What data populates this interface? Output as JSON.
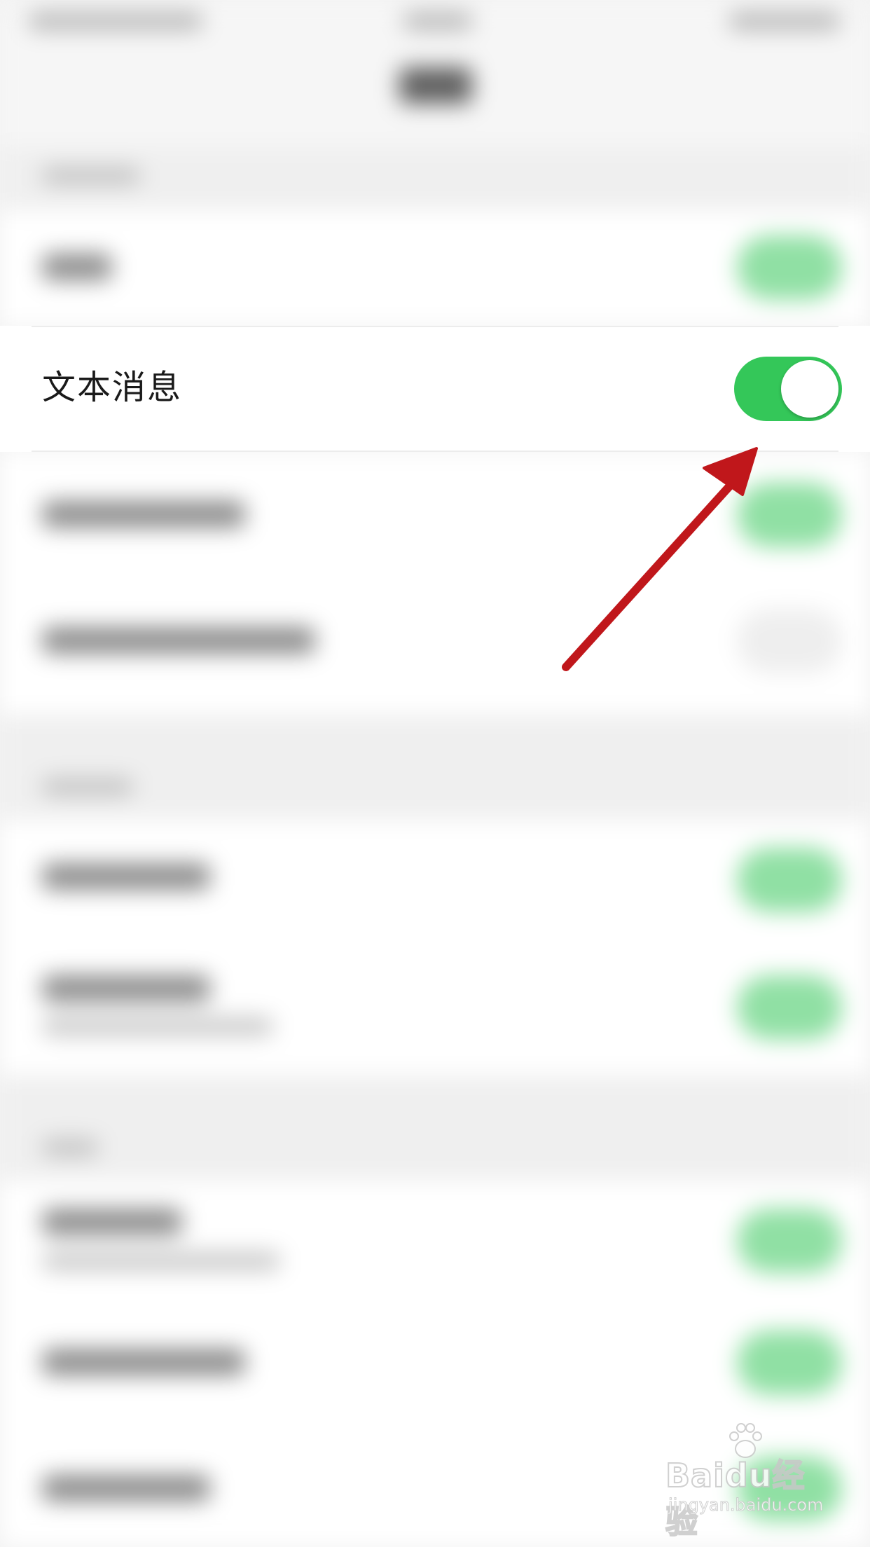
{
  "text_message_row": {
    "label": "文本消息",
    "toggle_on": true,
    "toggle_color": "#34c759"
  },
  "annotation": {
    "color": "#c0171b"
  },
  "watermark": {
    "brand": "Baidu经验",
    "url": "jingyan.baidu.com"
  }
}
